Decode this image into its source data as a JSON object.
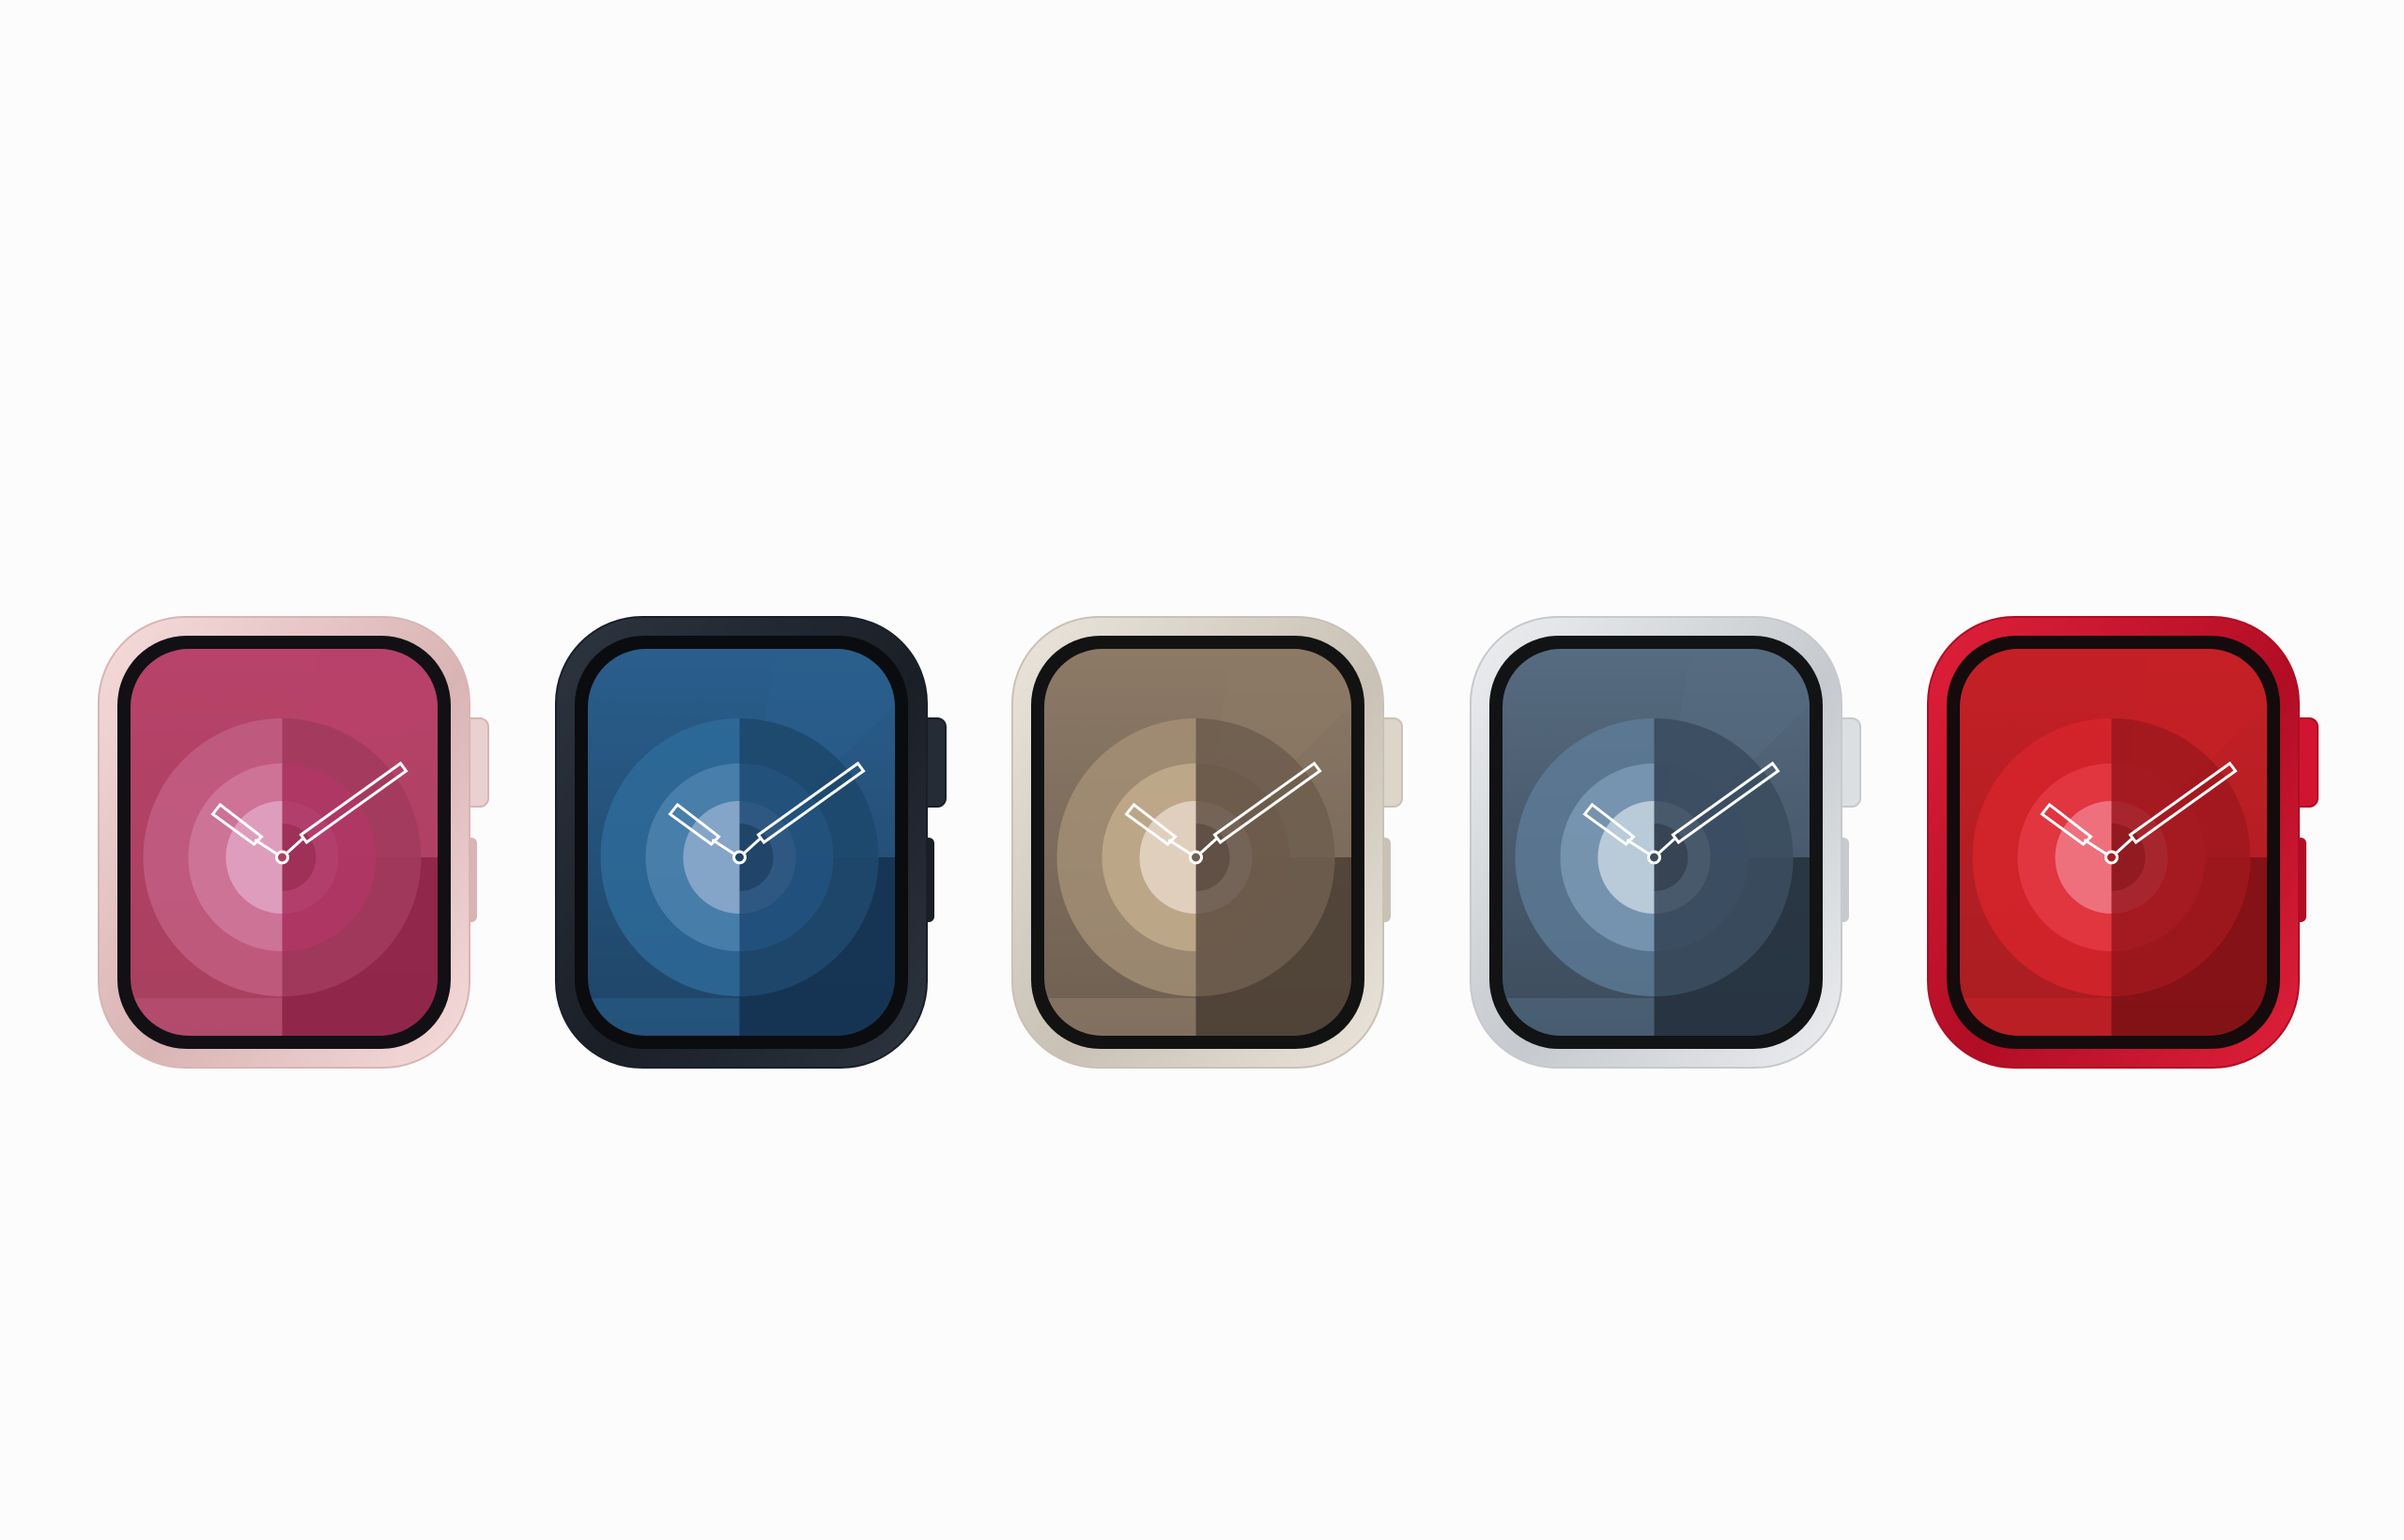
{
  "background": "#fcfcfc",
  "watches": [
    {
      "finish": "pink",
      "case_light": "#f6dcdc",
      "case_dark": "#d9b4b4",
      "bezel": "#131015",
      "crown": "#ead0d0",
      "face_bg": "#a8405f",
      "face_top": "#b8426a",
      "face_dark_half": "#8c2346",
      "ring_outer": "#c46286",
      "ring_mid": "#d1799c",
      "ring_inner": "#e2a4c4",
      "right_inner": "#b32a5f",
      "hands": "#ffffff"
    },
    {
      "finish": "midnight",
      "case_light": "#2d3540",
      "case_dark": "#1a1f27",
      "bezel": "#0b0c10",
      "crown": "#262c35",
      "face_bg": "#1f4467",
      "face_top": "#2a5e8c",
      "face_dark_half": "#143150",
      "ring_outer": "#2f6d9d",
      "ring_mid": "#4f84af",
      "ring_inner": "#8faccd",
      "right_inner": "#1c4f80",
      "hands": "#ffffff"
    },
    {
      "finish": "starlight",
      "case_light": "#ebe5dc",
      "case_dark": "#c9c1b5",
      "bezel": "#121212",
      "crown": "#ddd5ca",
      "face_bg": "#6d5f52",
      "face_top": "#8c7a66",
      "face_dark_half": "#4b3e34",
      "ring_outer": "#a89378",
      "ring_mid": "#c4ae8e",
      "ring_inner": "#e8d6c8",
      "right_inner": "#5e4d40",
      "hands": "#ffffff"
    },
    {
      "finish": "silver",
      "case_light": "#eceef0",
      "case_dark": "#c6c9cd",
      "bezel": "#121315",
      "crown": "#dcdfe2",
      "face_bg": "#3c4b5c",
      "face_top": "#566b80",
      "face_dark_half": "#24303d",
      "ring_outer": "#5f7d99",
      "ring_mid": "#7d9bb6",
      "ring_inner": "#c5d3e0",
      "right_inner": "#2f4257",
      "hands": "#ffffff"
    },
    {
      "finish": "red",
      "case_light": "#e0203a",
      "case_dark": "#b10d25",
      "bezel": "#150a0c",
      "crown": "#d11530",
      "face_bg": "#a81d22",
      "face_top": "#c42026",
      "face_dark_half": "#7c1014",
      "ring_outer": "#d9262c",
      "ring_mid": "#e53a45",
      "ring_inner": "#f07a88",
      "right_inner": "#a0161c",
      "hands": "#ffffff"
    }
  ]
}
